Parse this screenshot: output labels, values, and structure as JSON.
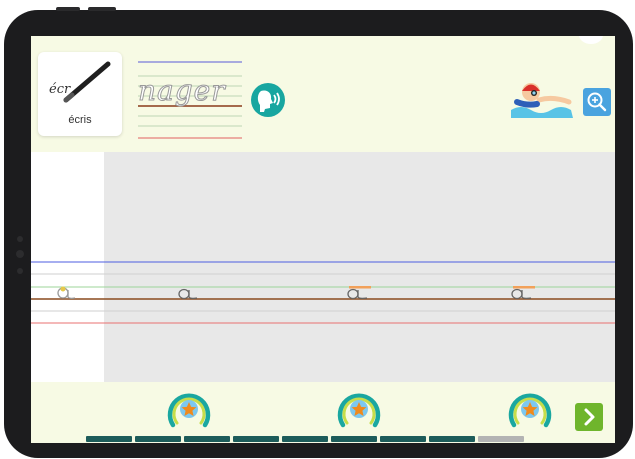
{
  "mode_card": {
    "icon": "pencil-icon",
    "sample": "écr",
    "label": "écris"
  },
  "word": {
    "text": "nager"
  },
  "audio": {
    "icon": "speaker-head-icon",
    "color": "#18a6a0"
  },
  "illustration": {
    "icon": "swimmer-illustration"
  },
  "zoom": {
    "icon": "zoom-in-icon",
    "color": "#4aa3df"
  },
  "exercise": {
    "letters": [
      {
        "text": "a",
        "state": "traced"
      },
      {
        "text": "a",
        "state": "model"
      },
      {
        "text": "a",
        "state": "model-with-hint"
      },
      {
        "text": "a",
        "state": "model-with-hint"
      }
    ]
  },
  "rewards": [
    {
      "icon": "star-reward-icon"
    },
    {
      "icon": "star-reward-icon"
    },
    {
      "icon": "star-reward-icon"
    }
  ],
  "next": {
    "icon": "chevron-right-icon",
    "color": "#6fb52c"
  },
  "progress": {
    "total": 9,
    "completed": 8,
    "done_color": "#1d5c5a",
    "todo_color": "#b3b3b3"
  },
  "colors": {
    "line_blue": "#4c5ee0",
    "line_green": "#9cd49a",
    "line_brown": "#8a4a1f",
    "line_red": "#e87070",
    "line_grey": "#cfcfcf",
    "hint_orange": "#f2a15a"
  }
}
